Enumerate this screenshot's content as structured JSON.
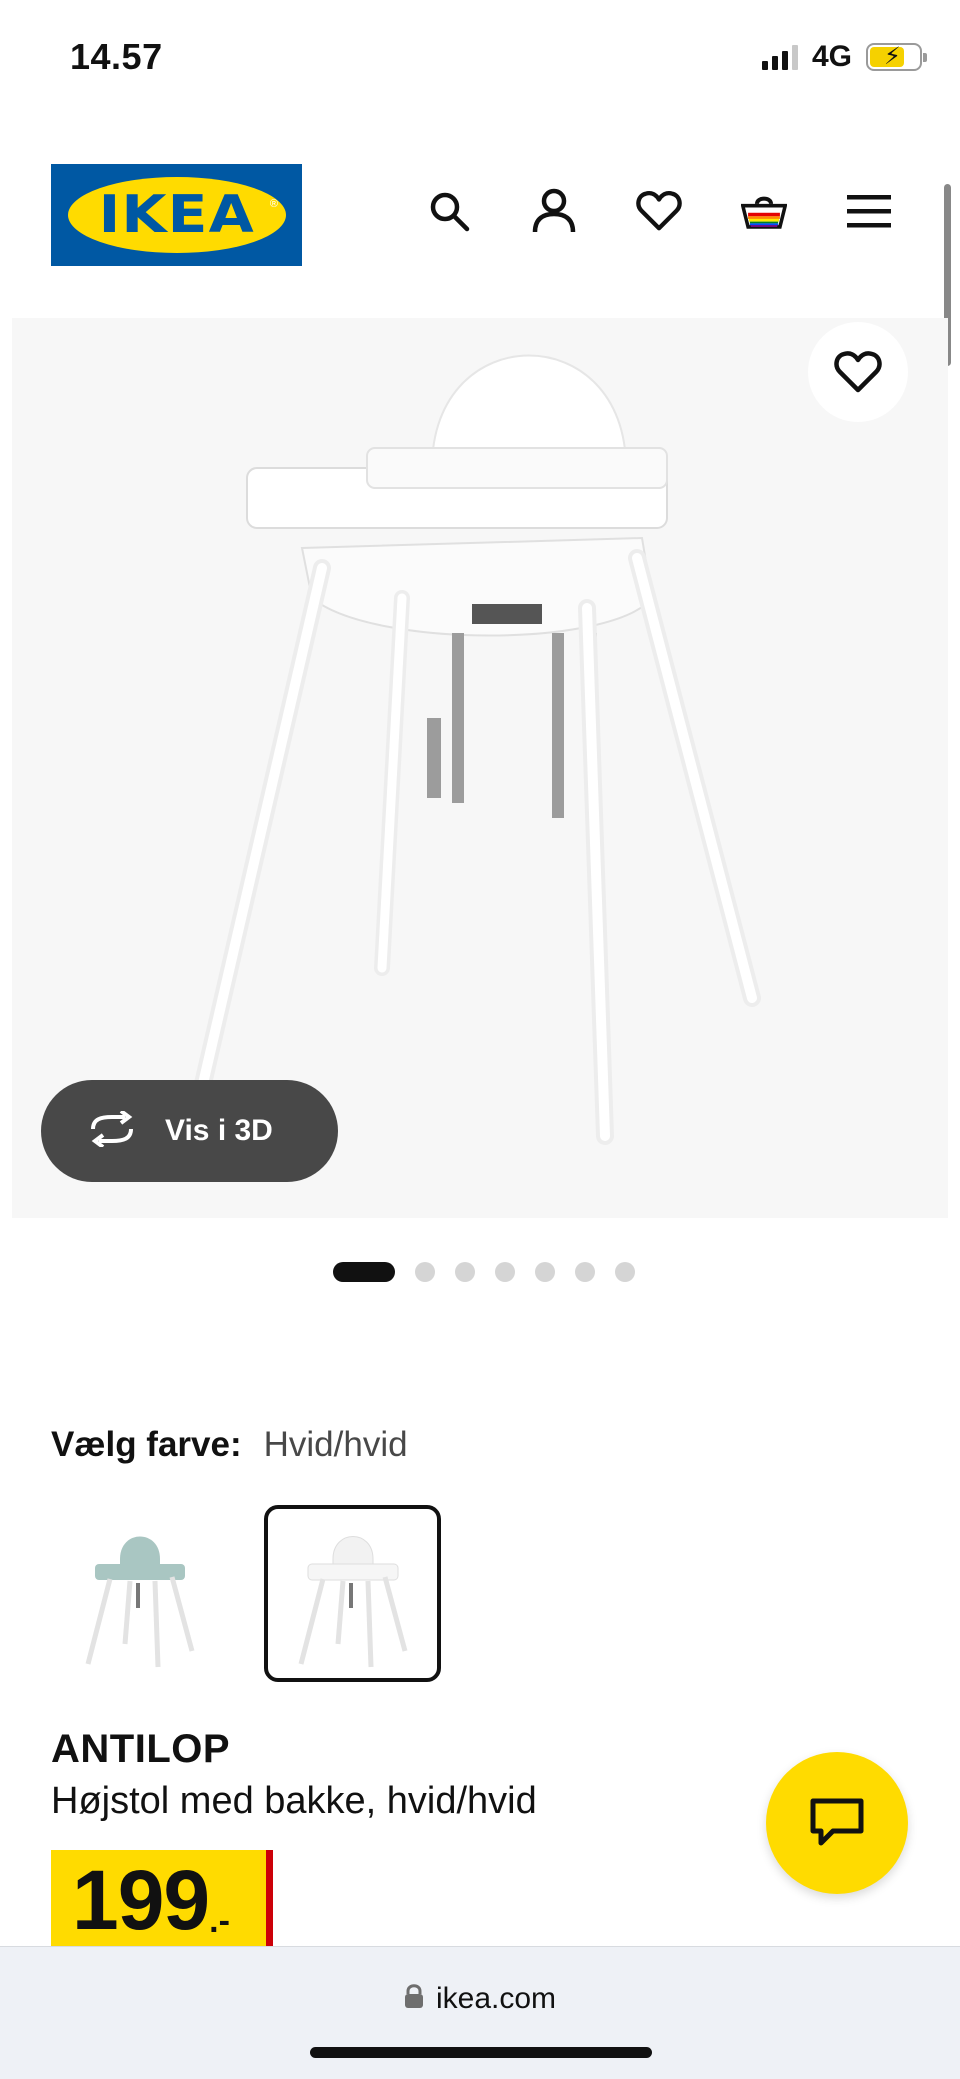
{
  "status_bar": {
    "time": "14.57",
    "network": "4G"
  },
  "header": {
    "logo_text": "IKEA",
    "logo_reg": "®",
    "icons": [
      "search-icon",
      "account-icon",
      "heart-icon",
      "basket-icon",
      "menu-icon"
    ]
  },
  "gallery": {
    "view3d_label": "Vis i 3D",
    "dot_count": 7,
    "active_index": 0
  },
  "color_select": {
    "label": "Vælg farve:",
    "value": "Hvid/hvid"
  },
  "product": {
    "name": "ANTILOP",
    "description": "Højstol med bakke, hvid/hvid",
    "price": "199",
    "price_suffix": ".-"
  },
  "browser": {
    "url": "ikea.com"
  },
  "colors": {
    "ikea_blue": "#0058a3",
    "ikea_yellow": "#ffdb00",
    "price_red": "#cc0008",
    "chip_dark": "#484848"
  }
}
